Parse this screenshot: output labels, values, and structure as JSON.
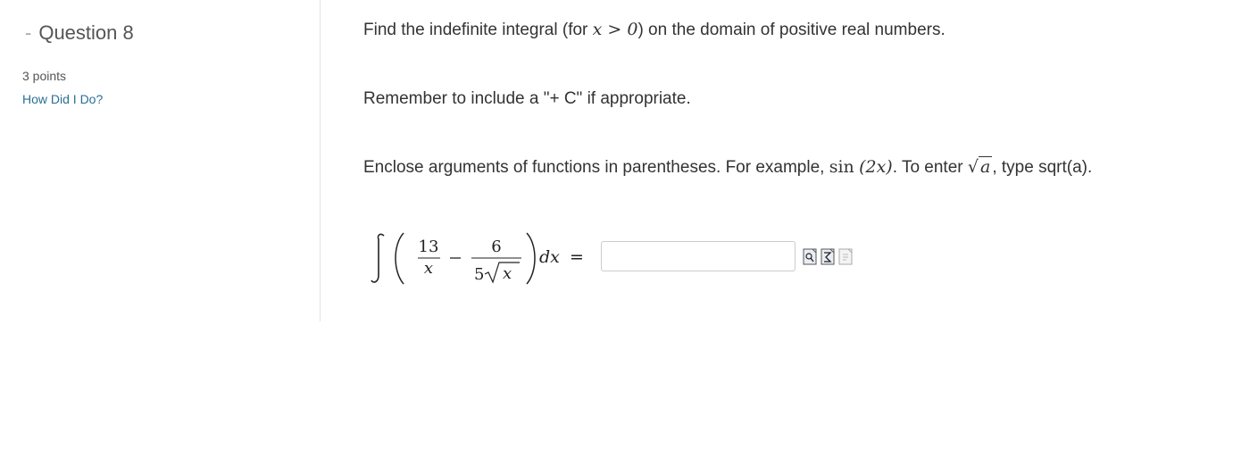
{
  "question": {
    "title": "Question 8",
    "points": "3 points",
    "help_link": "How Did I Do?"
  },
  "content": {
    "p1_text_a": "Find the indefinite integral (for ",
    "p1_math": "x > 0",
    "p1_text_b": ") on the domain of positive real numbers.",
    "p2": "Remember to include a \"+ C\" if appropriate.",
    "p3_text_a": "Enclose arguments of functions in parentheses. For example, ",
    "p3_math_fn": "sin",
    "p3_math_arg": "(2x)",
    "p3_text_b": ". To enter ",
    "p3_sqrt_arg": "a",
    "p3_text_c": ", type sqrt(a)."
  },
  "equation": {
    "frac1_num": "13",
    "frac1_den": "x",
    "minus": "−",
    "frac2_num": "6",
    "frac2_den_coef": "5",
    "frac2_den_rad": "x",
    "differential": "dx",
    "equals": "="
  },
  "answer": {
    "value": "",
    "placeholder": ""
  },
  "tools": [
    "equation-editor-icon",
    "symbol-palette-icon",
    "preview-icon"
  ]
}
